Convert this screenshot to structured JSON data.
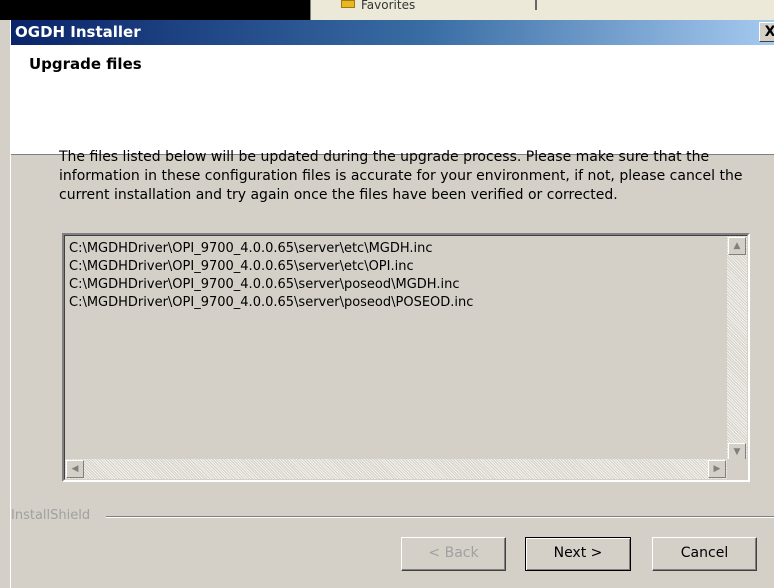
{
  "background": {
    "favorites_label": "Favorites"
  },
  "dialog": {
    "title": "OGDH Installer",
    "close_glyph": "X",
    "header_title": "Upgrade files",
    "description": "The files listed below will be updated during the upgrade process. Please make sure that the information in these configuration files is accurate for your environment, if not, please cancel the current installation and try again once the files have been verified or corrected.",
    "files": [
      "C:\\MGDHDriver\\OPI_9700_4.0.0.65\\server\\etc\\MGDH.inc",
      "C:\\MGDHDriver\\OPI_9700_4.0.0.65\\server\\etc\\OPI.inc",
      "C:\\MGDHDriver\\OPI_9700_4.0.0.65\\server\\poseod\\MGDH.inc",
      "C:\\MGDHDriver\\OPI_9700_4.0.0.65\\server\\poseod\\POSEOD.inc"
    ],
    "brand_label": "InstallShield",
    "buttons": {
      "back": "< Back",
      "next": "Next >",
      "cancel": "Cancel"
    }
  },
  "colors": {
    "titlebar_start": "#0a246a",
    "titlebar_end": "#a6caf0",
    "face": "#d4d0c8"
  }
}
